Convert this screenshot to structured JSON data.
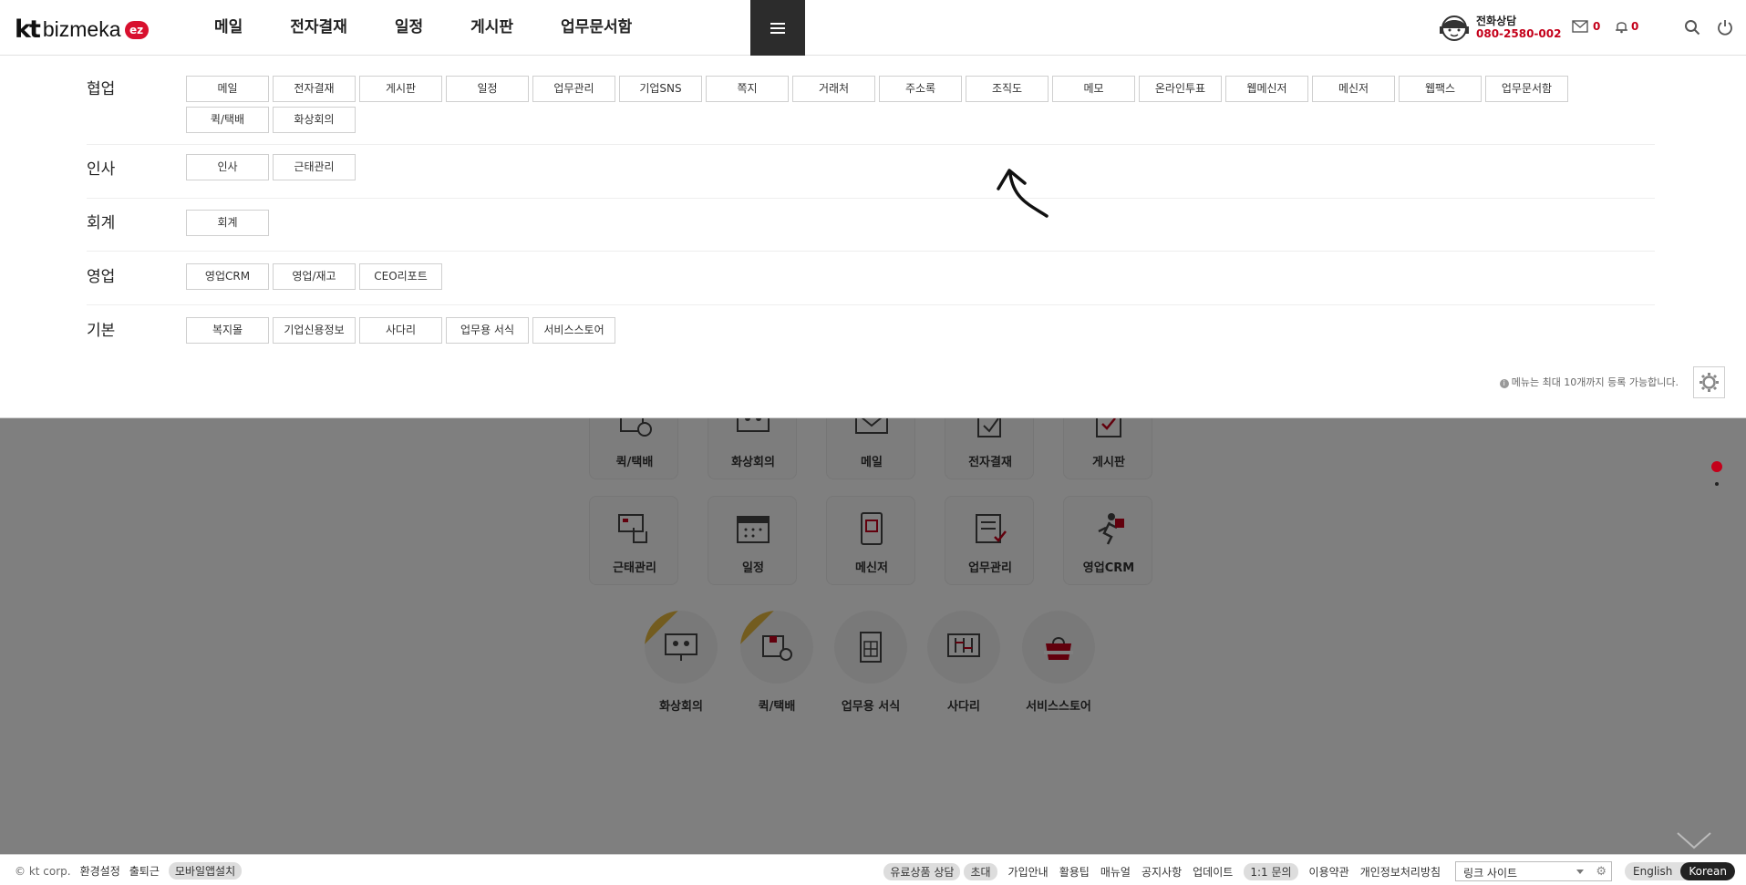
{
  "header": {
    "logo_kt": "kt",
    "logo_name": "bizmeka",
    "logo_badge": "ez",
    "nav": [
      "메일",
      "전자결재",
      "일정",
      "게시판",
      "업무문서함"
    ],
    "tel_label": "전화상담",
    "tel_number": "080-2580-002",
    "mail_count": "0",
    "alarm_count": "0"
  },
  "menu": {
    "categories": [
      {
        "title": "협업",
        "items": [
          "메일",
          "전자결재",
          "게시판",
          "일정",
          "업무관리",
          "기업SNS",
          "쪽지",
          "거래처",
          "주소록",
          "조직도",
          "메모",
          "온라인투표",
          "웹메신저",
          "메신저",
          "웹팩스",
          "업무문서함",
          "퀵/택배",
          "화상회의"
        ]
      },
      {
        "title": "인사",
        "items": [
          "인사",
          "근태관리"
        ]
      },
      {
        "title": "회계",
        "items": [
          "회계"
        ]
      },
      {
        "title": "영업",
        "items": [
          "영업CRM",
          "영업/재고",
          "CEO리포트"
        ]
      },
      {
        "title": "기본",
        "items": [
          "복지몰",
          "기업신용정보",
          "사다리",
          "업무용 서식",
          "서비스스토어"
        ]
      }
    ],
    "notice": "메뉴는 최대 10개까지 등록 가능합니다."
  },
  "dashboard": {
    "tiles_row1": [
      "퀵/택배",
      "화상회의",
      "메일",
      "전자결재",
      "게시판"
    ],
    "tiles_row2": [
      "근태관리",
      "일정",
      "메신저",
      "업무관리",
      "영업CRM"
    ],
    "circles": [
      "화상회의",
      "퀵/택배",
      "업무용 서식",
      "사다리",
      "서비스스토어"
    ]
  },
  "footer": {
    "copyright": "© kt corp.",
    "left": [
      "환경설정",
      "출퇴근",
      "모바일앱설치"
    ],
    "right": [
      "유료상품 상담",
      "초대",
      "가입안내",
      "활용팁",
      "매뉴얼",
      "공지사항",
      "업데이트",
      "1:1 문의",
      "이용약관",
      "개인정보처리방침"
    ],
    "link_select": "링크 사이트",
    "lang": [
      "English",
      "Korean"
    ]
  },
  "colors": {
    "accent": "#c4001a",
    "hamburger_bg": "#2c2c2c",
    "ribbon": "#e6b93f"
  }
}
